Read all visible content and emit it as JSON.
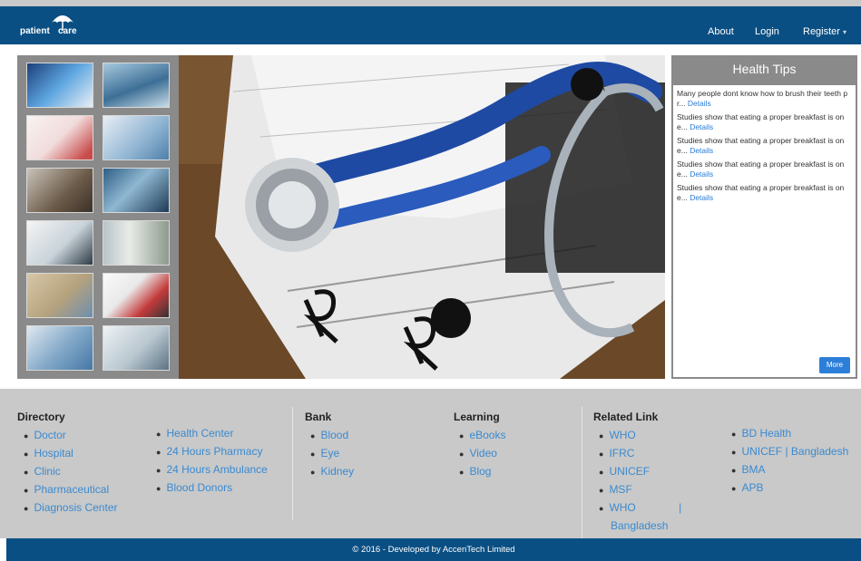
{
  "brand": {
    "logo_left": "patient",
    "logo_right": "care"
  },
  "nav": {
    "about": "About",
    "login": "Login",
    "register": "Register"
  },
  "health_tips": {
    "title": "Health Tips",
    "details_label": "Details",
    "more_label": "More",
    "items": [
      "Many people dont know how to brush their teeth pr...",
      "Studies show that eating a proper breakfast is one...",
      "Studies show that eating a proper breakfast is one...",
      "Studies show that eating a proper breakfast is one...",
      "Studies show that eating a proper breakfast is one..."
    ]
  },
  "footer": {
    "directory": {
      "title": "Directory",
      "col1": [
        "Doctor",
        "Hospital",
        "Clinic",
        "Pharmaceutical",
        "Diagnosis Center"
      ],
      "col2": [
        "Health Center",
        "24 Hours Pharmacy",
        "24 Hours Ambulance",
        "Blood Donors"
      ]
    },
    "bank": {
      "title": "Bank",
      "items": [
        "Blood",
        "Eye",
        "Kidney"
      ]
    },
    "learning": {
      "title": "Learning",
      "items": [
        "eBooks",
        "Video",
        "Blog"
      ]
    },
    "related": {
      "title": "Related Link",
      "col1": [
        "WHO",
        "IFRC",
        "UNICEF",
        "MSF",
        "WHO | Bangladesh"
      ],
      "col2": [
        "BD Health",
        "UNICEF | Bangladesh",
        "BMA",
        "APB"
      ]
    }
  },
  "copyright": "© 2016 - Developed by AccenTech Limited",
  "colors": {
    "navbar": "#0a4f83",
    "link": "#3a8ad0",
    "panel": "#8a8a8a",
    "footer": "#c9c9c9"
  }
}
